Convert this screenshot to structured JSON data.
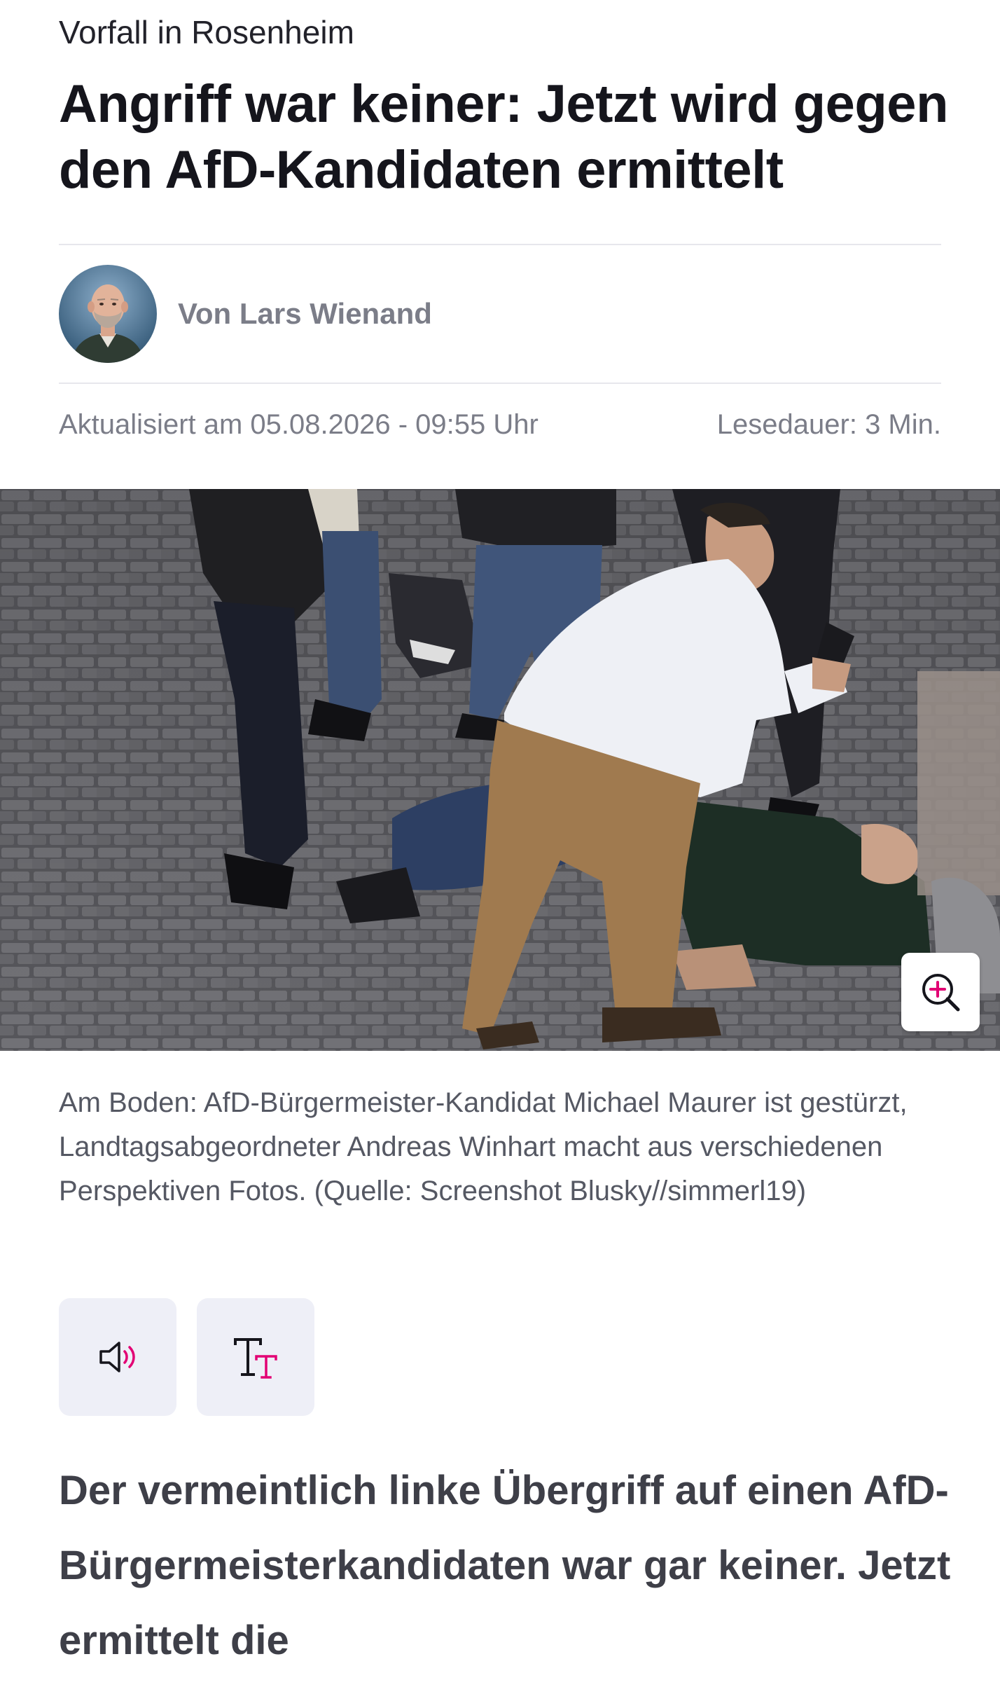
{
  "article": {
    "kicker": "Vorfall in Rosenheim",
    "headline": "Angriff war keiner: Jetzt wird gegen den AfD-Kandidaten ermittelt",
    "author": "Von Lars Wienand",
    "updated": "Aktualisiert am 05.08.2026 - 09:55 Uhr",
    "reading_time": "Lesedauer: 3 Min.",
    "caption": "Am Boden: AfD-Bürgermeister-Kandidat Michael Maurer ist gestürzt, Landtagsabgeordneter Andreas Winhart macht aus verschiedenen Perspektiven Fotos. (Quelle: Screenshot Blusky//simmerl19)",
    "lead": "Der vermeintlich linke Übergriff auf einen AfD-Bürgermeisterkandidaten war gar keiner. Jetzt ermittelt die"
  },
  "icons": {
    "zoom": "zoom-in-icon",
    "audio": "speaker-icon",
    "text_size": "text-size-icon"
  },
  "colors": {
    "accent": "#e20074",
    "button_bg": "#eeeff7",
    "meta_text": "#7b7d88"
  }
}
